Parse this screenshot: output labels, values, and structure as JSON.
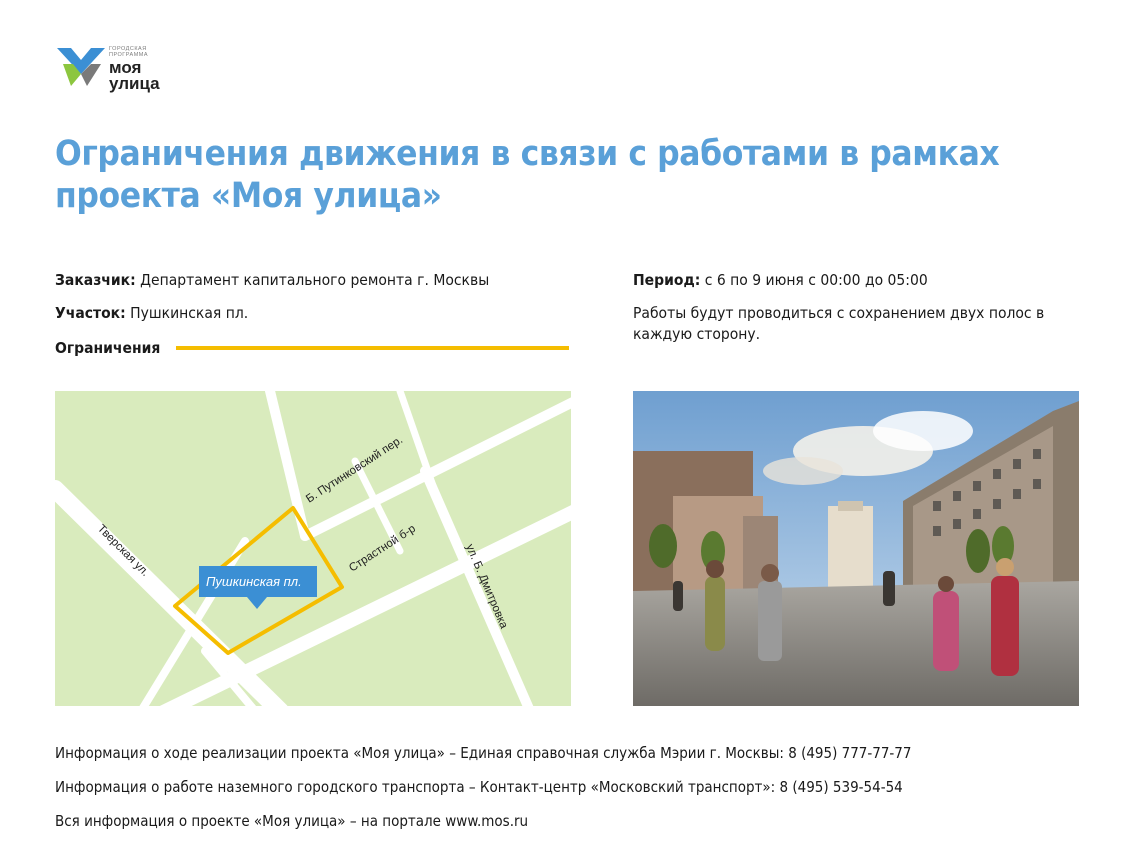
{
  "logo": {
    "eyebrow": "ГОРОДСКАЯ ПРОГРАММА",
    "line1": "моя",
    "line2": "улица",
    "colors": {
      "blue": "#3b8fd4",
      "green": "#8cc63f",
      "gray": "#7a7a7a"
    }
  },
  "title": "Ограничения движения в связи с работами в рамках проекта «Моя улица»",
  "details": {
    "customer_label": "Заказчик:",
    "customer_value": "Департамент капитального ремонта г. Москвы",
    "section_label": "Участок:",
    "section_value": "Пушкинская пл.",
    "restrictions_label": "Ограничения",
    "period_label": "Период:",
    "period_value": "с 6 по 9 июня с 00:00 до 05:00",
    "note": "Работы будут проводиться с сохранением двух полос в каждую сторону."
  },
  "map": {
    "streets": {
      "tverskaya": "Тверская ул.",
      "putinkovsky": "Б. Путинковский пер.",
      "strastnoy": "Страстной б-р",
      "dmitrovka": "ул. Б. Дмитровка"
    },
    "marker_label": "Пушкинская пл.",
    "colors": {
      "land": "#d9ebbd",
      "road": "#ffffff",
      "zone": "#f5bd00",
      "marker": "#3b8fd4"
    }
  },
  "footer": {
    "line1": "Информация о ходе реализации проекта «Моя улица» – Единая справочная служба Мэрии г. Москвы: 8 (495) 777-77-77",
    "line2": "Информация о работе наземного городского транспорта – Контакт-центр «Московский транспорт»: 8 (495) 539-54-54",
    "line3": "Вся информация о проекте «Моя улица» – на портале www.mos.ru"
  }
}
